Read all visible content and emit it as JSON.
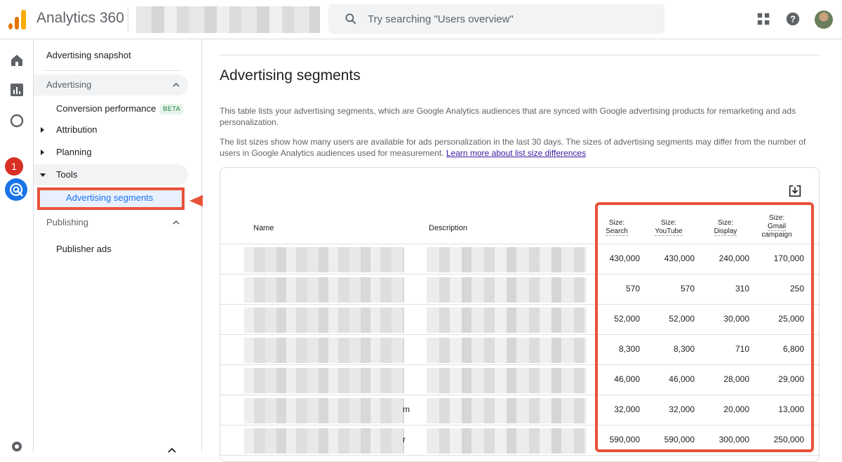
{
  "header": {
    "app_title": "Analytics 360",
    "search_placeholder": "Try searching \"Users overview\"",
    "icons": [
      "apps-grid-icon",
      "help-icon",
      "account-avatar"
    ]
  },
  "rail": {
    "icons": [
      "home-icon",
      "reports-icon",
      "explore-icon",
      "advertising-icon",
      "settings-icon"
    ],
    "badge": "1"
  },
  "nav": {
    "snapshot": "Advertising snapshot",
    "advertising_section": "Advertising",
    "conversion_performance": "Conversion performance",
    "beta": "BETA",
    "attribution": "Attribution",
    "planning": "Planning",
    "tools": "Tools",
    "advertising_segments": "Advertising segments",
    "publishing_section": "Publishing",
    "publisher_ads": "Publisher ads"
  },
  "main": {
    "title": "Advertising segments",
    "desc1": "This table lists your advertising segments, which are Google Analytics audiences that are synced with Google advertising products for remarketing and ads personalization.",
    "desc2": "The list sizes show how many users are available for ads personalization in the last 30 days. The sizes of advertising segments may differ from the number of users in Google Analytics audiences used for measurement.",
    "learn_more": "Learn more about list size differences"
  },
  "table": {
    "col_name": "Name",
    "col_description": "Description",
    "metric_headers": [
      {
        "l1": "Size:",
        "l2": "Search",
        "l3": ""
      },
      {
        "l1": "Size:",
        "l2": "YouTube",
        "l3": ""
      },
      {
        "l1": "Size:",
        "l2": "Display",
        "l3": ""
      },
      {
        "l1": "Size:",
        "l2": "Gmail",
        "l3": "campaign"
      }
    ],
    "rows": [
      [
        "430,000",
        "430,000",
        "240,000",
        "170,000"
      ],
      [
        "570",
        "570",
        "310",
        "250"
      ],
      [
        "52,000",
        "52,000",
        "30,000",
        "25,000"
      ],
      [
        "8,300",
        "8,300",
        "710",
        "6,800"
      ],
      [
        "46,000",
        "46,000",
        "28,000",
        "29,000"
      ],
      [
        "32,000",
        "32,000",
        "20,000",
        "13,000"
      ],
      [
        "590,000",
        "590,000",
        "300,000",
        "250,000"
      ]
    ],
    "row_name_fragments": [
      "",
      "",
      "",
      "",
      "",
      "m",
      "r"
    ]
  },
  "colors": {
    "annotation": "#e8523a",
    "accent": "#1a73e8"
  }
}
